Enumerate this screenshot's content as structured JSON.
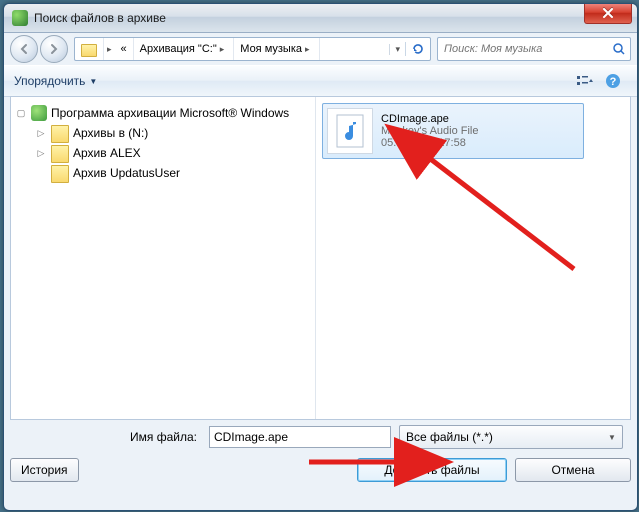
{
  "window": {
    "title": "Поиск файлов в архиве"
  },
  "breadcrumb": {
    "ellipsis": "«",
    "seg1": "Архивация \"C:\"",
    "seg2": "Моя музыка"
  },
  "search": {
    "placeholder": "Поиск: Моя музыка"
  },
  "toolbar": {
    "organize": "Упорядочить"
  },
  "tree": {
    "root": "Программа архивации Microsoft® Windows",
    "children": [
      {
        "label": "Архивы в (N:)"
      },
      {
        "label": "Архив ALEX"
      },
      {
        "label": "Архив UpdatusUser"
      }
    ]
  },
  "file": {
    "name": "CDImage.ape",
    "type": "Monkey's Audio File",
    "date": "05.03.2011 17:58"
  },
  "bottom": {
    "filename_label": "Имя файла:",
    "filename_value": "CDImage.ape",
    "filter": "Все файлы (*.*)",
    "history": "История",
    "add": "Добавить файлы",
    "cancel": "Отмена"
  }
}
